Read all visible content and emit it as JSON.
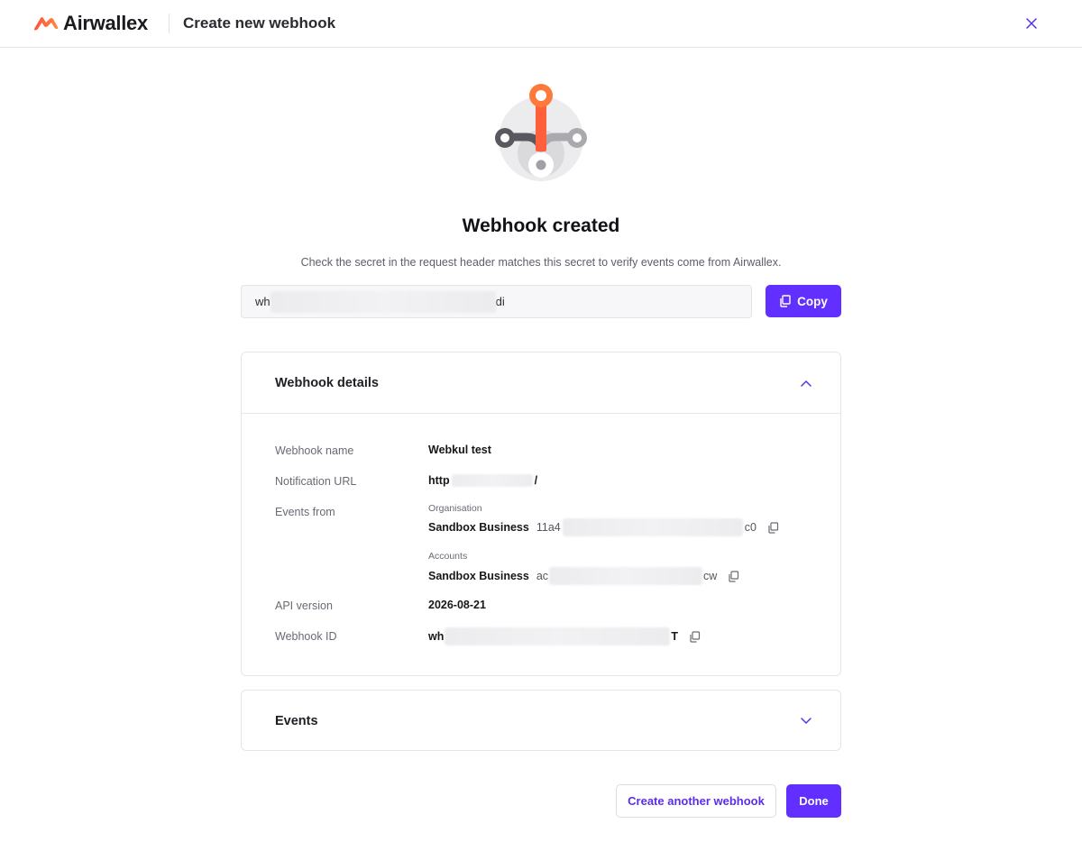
{
  "header": {
    "brand": "Airwallex",
    "title": "Create new webhook",
    "close_icon": "close-icon"
  },
  "hero": {
    "icon": "webhook-icon",
    "title": "Webhook created",
    "subtitle": "Check the secret in the request header matches this secret to verify events come from Airwallex."
  },
  "secret": {
    "prefix": "wh",
    "suffix": "di",
    "copy_label": "Copy"
  },
  "details": {
    "title": "Webhook details",
    "webhook_name_label": "Webhook name",
    "webhook_name": "Webkul test",
    "notification_url_label": "Notification URL",
    "notification_url_prefix": "http",
    "notification_url_suffix": "/",
    "events_from_label": "Events from",
    "organisation_label": "Organisation",
    "organisation_name": "Sandbox Business",
    "organisation_id_prefix": "11a4",
    "organisation_id_suffix": "c0",
    "accounts_label": "Accounts",
    "account_name": "Sandbox Business",
    "account_id_prefix": "ac",
    "account_id_suffix": "cw",
    "api_version_label": "API version",
    "api_version": "2026-08-21",
    "webhook_id_label": "Webhook ID",
    "webhook_id_prefix": "wh",
    "webhook_id_suffix": "T"
  },
  "events": {
    "title": "Events"
  },
  "footer": {
    "create_another_label": "Create another webhook",
    "done_label": "Done"
  },
  "colors": {
    "primary": "#612fff",
    "brand_orange": "#ff5f3a",
    "text": "#1b1b1f",
    "muted": "#6a6a74"
  }
}
